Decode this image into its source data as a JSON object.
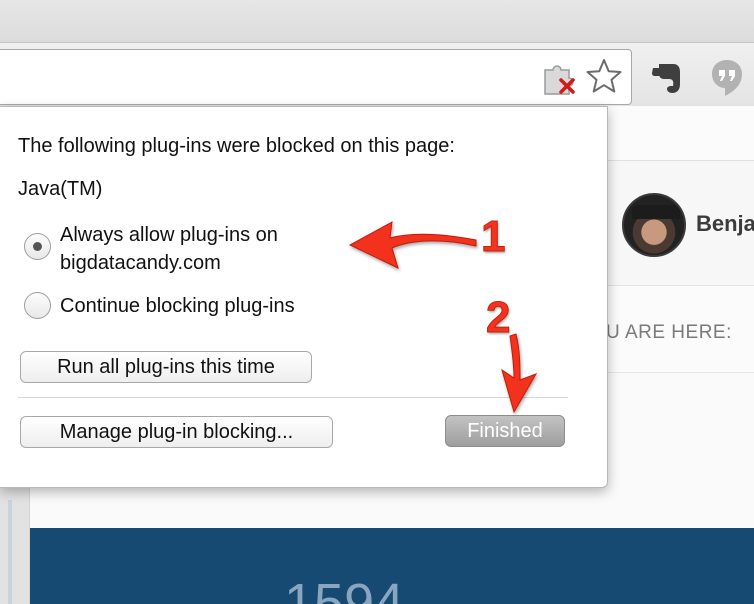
{
  "browser": {
    "address_value": "",
    "icons": [
      "blocked-plugin-icon",
      "bookmark-star-icon",
      "evernote-icon",
      "hangouts-icon"
    ]
  },
  "page": {
    "user_name": "Benja",
    "breadcrumb": "U ARE HERE:",
    "stat_number": "1594"
  },
  "bubble": {
    "title": "The following plug-ins were blocked on this page:",
    "plugin": "Java(TM)",
    "options": [
      {
        "label_line1": "Always allow plug-ins on",
        "label_line2": "bigdatacandy.com",
        "checked": true
      },
      {
        "label": "Continue blocking plug-ins",
        "checked": false
      }
    ],
    "run_all_label": "Run all plug-ins this time",
    "manage_label": "Manage plug-in blocking...",
    "finished_label": "Finished"
  },
  "annotations": {
    "step1": "1",
    "step2": "2",
    "color": "#f2331d"
  }
}
